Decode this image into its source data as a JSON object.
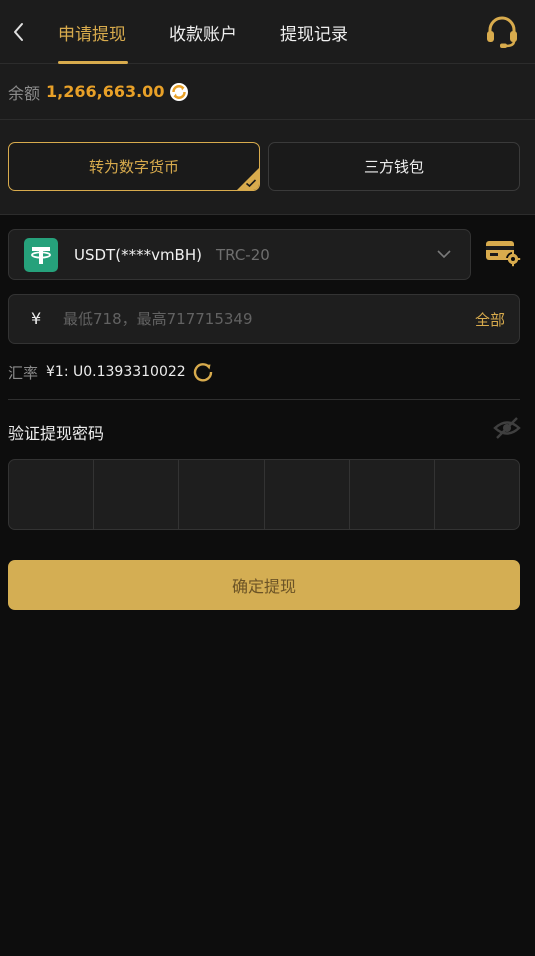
{
  "header": {
    "tabs": [
      {
        "label": "申请提现",
        "active": true
      },
      {
        "label": "收款账户",
        "active": false
      },
      {
        "label": "提现记录",
        "active": false
      }
    ]
  },
  "balance": {
    "label": "余额",
    "value": "1,266,663.00"
  },
  "methods": [
    {
      "label": "转为数字货币",
      "selected": true
    },
    {
      "label": "三方钱包",
      "selected": false
    }
  ],
  "currency": {
    "name": "USDT(****vmBH)",
    "network": "TRC-20"
  },
  "amount": {
    "symbol": "¥",
    "placeholder": "最低718，最高717715349",
    "all_label": "全部"
  },
  "rate": {
    "label": "汇率",
    "value": "¥1: U0.1393310022"
  },
  "password": {
    "title": "验证提现密码",
    "cells": 6
  },
  "submit_label": "确定提现",
  "colors": {
    "accent": "#d8ab4d",
    "balance": "#e9a128",
    "tether": "#26a17b",
    "background": "#0d0d0d",
    "panel": "#1c1c1c"
  }
}
